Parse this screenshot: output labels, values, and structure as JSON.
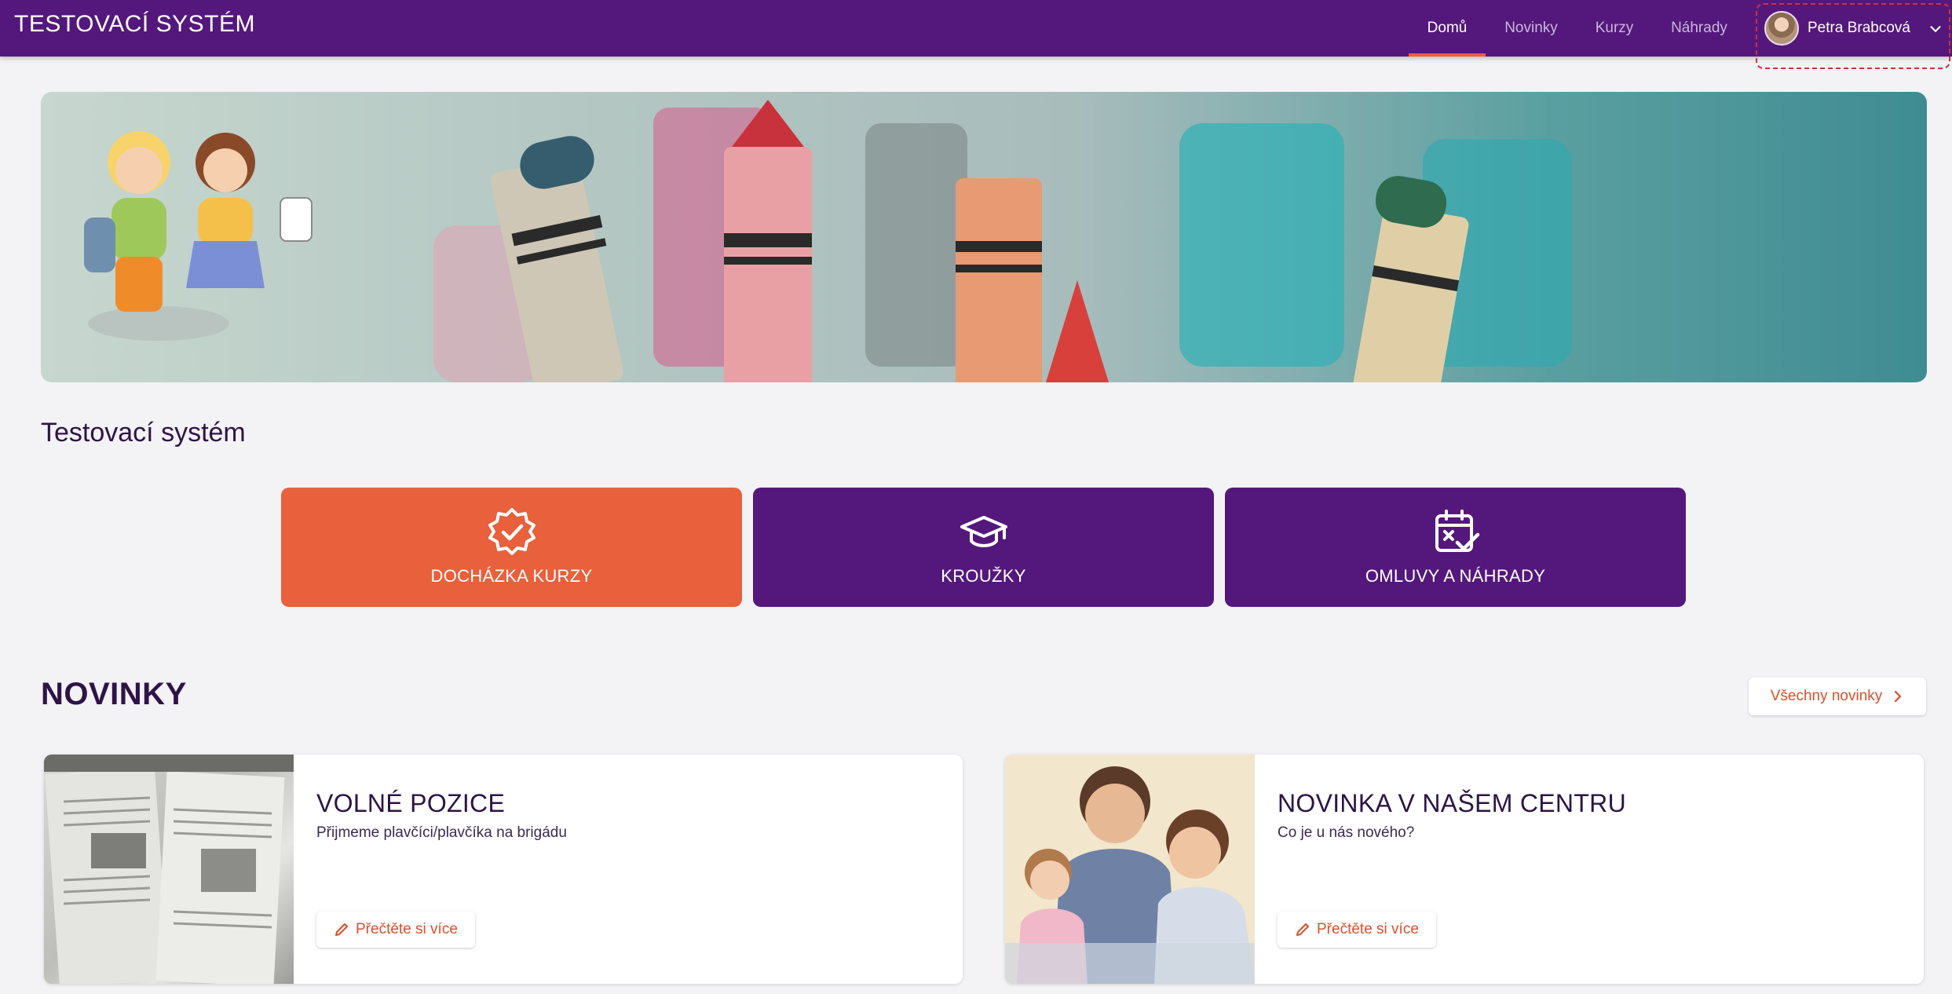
{
  "header": {
    "brand": "TESTOVACÍ SYSTÉM",
    "nav": [
      {
        "label": "Domů",
        "active": true
      },
      {
        "label": "Novinky",
        "active": false
      },
      {
        "label": "Kurzy",
        "active": false
      },
      {
        "label": "Náhrady",
        "active": false
      }
    ],
    "user": {
      "name": "Petra Brabcová",
      "icon": "chevron-down-icon"
    }
  },
  "main": {
    "section_title": "Testovací systém",
    "tiles": [
      {
        "label": "DOCHÁZKA KURZY",
        "icon": "badge-check-icon",
        "color": "#e8603c"
      },
      {
        "label": "KROUŽKY",
        "icon": "graduation-cap-icon",
        "color": "#54187c"
      },
      {
        "label": "OMLUVY A NÁHRADY",
        "icon": "calendar-check-icon",
        "color": "#54187c"
      }
    ]
  },
  "news": {
    "title": "NOVINKY",
    "all_button": "Všechny novinky",
    "cards": [
      {
        "title": "VOLNÉ POZICE",
        "text": "Přijmeme plavčíci/plavčíka na brigádu",
        "button": "Přečtěte si více"
      },
      {
        "title": "NOVINKA V NAŠEM CENTRU",
        "text": "Co je u nás nového?",
        "button": "Přečtěte si více"
      }
    ]
  },
  "colors": {
    "primary": "#54187c",
    "accent": "#e8603c",
    "background": "#f3f2f5"
  }
}
